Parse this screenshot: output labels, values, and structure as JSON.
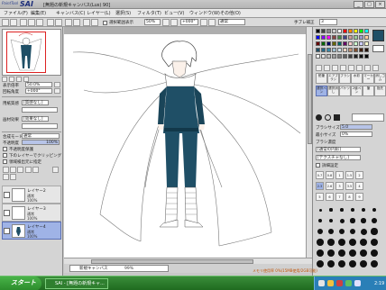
{
  "app": {
    "logo_text": "PaintTool",
    "logo_sai": "SAI",
    "title": "[無題の新規キャンバス(Lus) 90]"
  },
  "menu": [
    "ファイル(F)",
    "編集(E)",
    "キャンバス(C)",
    "レイヤー(L)",
    "選択(S)",
    "フィルタ(T)",
    "ビュー(V)",
    "ウィンドウ(W)",
    "その他(O)"
  ],
  "toolbar": {
    "selection_label": "選択範囲表示",
    "zoom_value": "50%",
    "angle_value": "+000°",
    "mode_value": "通常",
    "stabilizer_label": "手ブレ補正",
    "stabilizer_value": "3"
  },
  "left": {
    "zoom_label": "表示倍率",
    "zoom_value": "50.0%",
    "angle_label": "回転角度",
    "angle_value": "+000°",
    "paper_label": "用紙質感",
    "paper_value": "[質感なし]",
    "effect_label": "画材効果",
    "effect_value": "[効果なし]",
    "blend_label": "合成モード",
    "blend_value": "通常",
    "opacity_label": "不透明度",
    "opacity_value": "100%",
    "check_preserve": "不透明度保護",
    "check_clip": "下のレイヤーでクリッピング",
    "check_ref": "領域検出元に指定",
    "layers": [
      {
        "name": "レイヤー2",
        "mode": "通常",
        "pct": "100%",
        "selected": false
      },
      {
        "name": "レイヤー3",
        "mode": "通常",
        "pct": "100%",
        "selected": false
      },
      {
        "name": "レイヤー4",
        "mode": "通常",
        "pct": "100%",
        "selected": true
      }
    ]
  },
  "canvas": {
    "tab_name": "新規キャンバス",
    "tab_zoom": "99%"
  },
  "right": {
    "color_hex": "#1f4f66",
    "tools": [
      "鉛筆",
      "エアブラシ",
      "ブラシ",
      "水彩",
      "マーカー",
      "消しゴム",
      "選択ペン",
      "選択消し",
      "バケツ",
      "2値ペン",
      "筆",
      "指先"
    ],
    "density_label": "ブラシサイズ",
    "density_value": "5.0",
    "min_size_label": "最小サイズ",
    "min_size_value": "0%",
    "density2_label": "ブラシ濃度",
    "blend_shape": "[通常の円形]",
    "texture": "[テクスチャなし]",
    "detail_label": "詳細設定",
    "size_rows": [
      [
        "0.7",
        "0.8",
        "1",
        "1.5",
        "2"
      ],
      [
        "2.3",
        "2.6",
        "3",
        "3.5",
        "4"
      ],
      [
        "5",
        "6",
        "7",
        "8",
        "9"
      ]
    ]
  },
  "status_text": "メモリ使用率 0%(15MB使用/2GB可能)",
  "taskbar": {
    "start": "スタート",
    "task": "SAI - [無題の新規キャ...",
    "clock": "2:19"
  }
}
